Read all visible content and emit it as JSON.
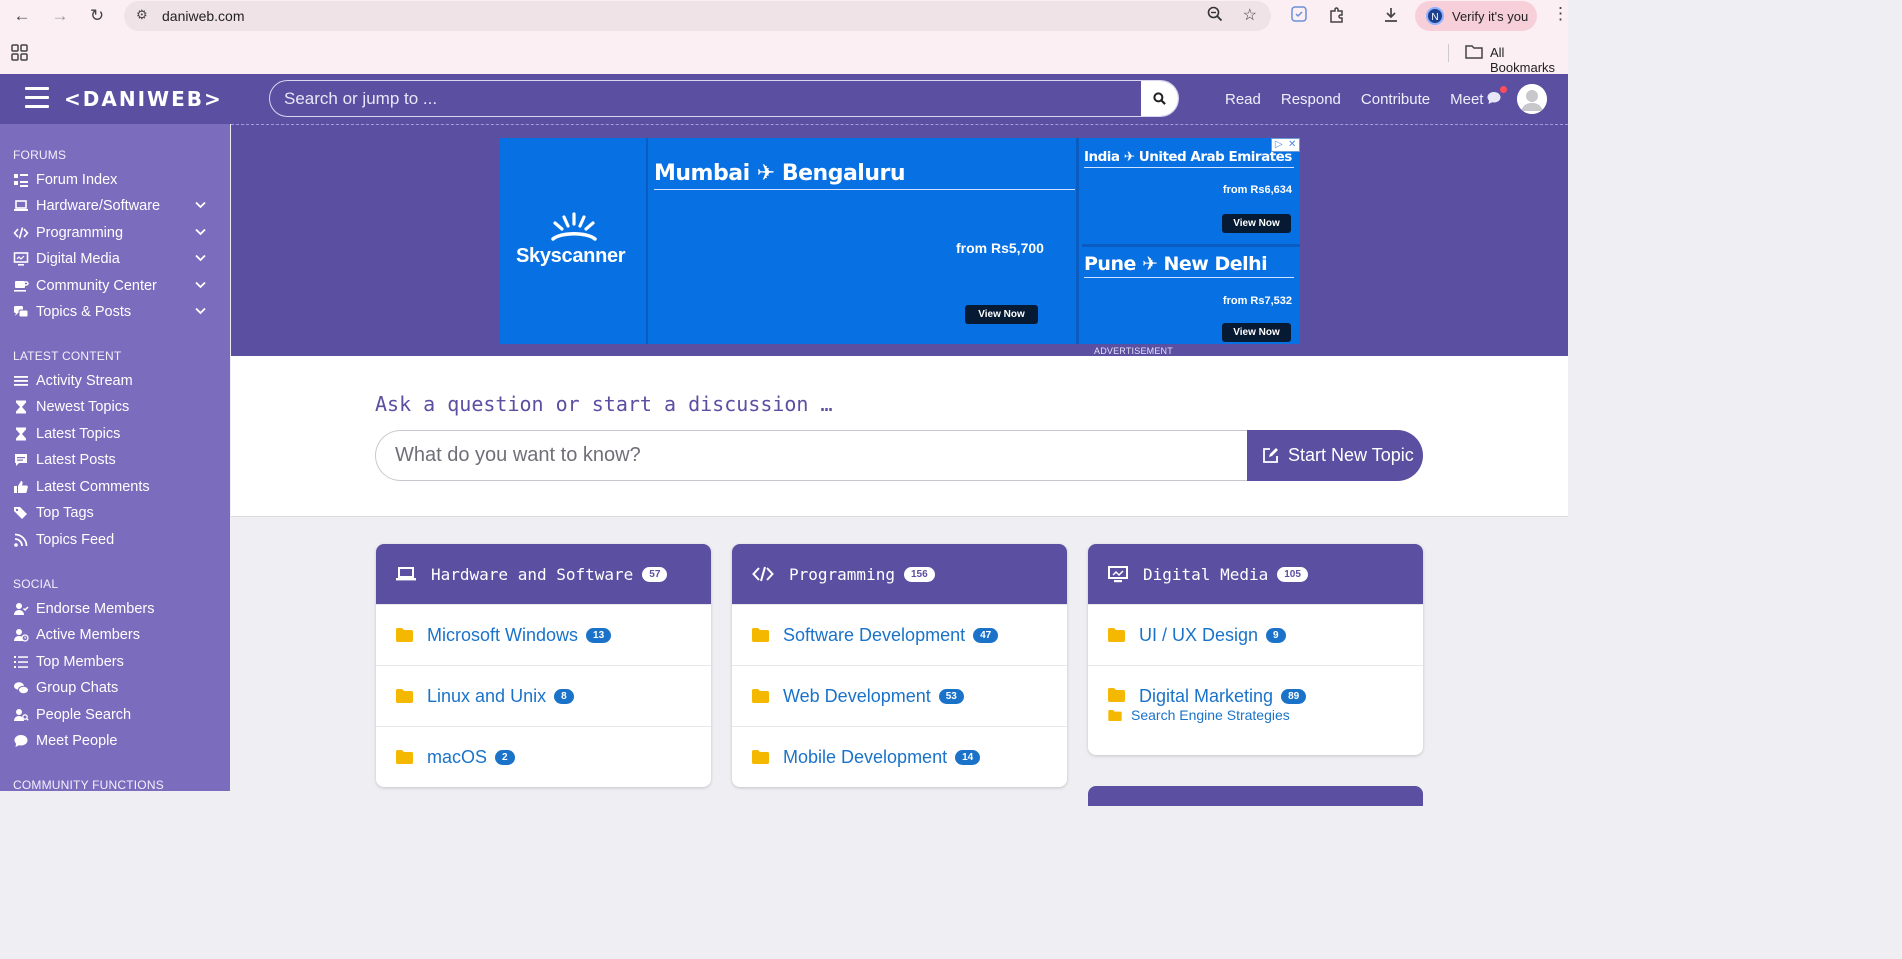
{
  "browser": {
    "url": "daniweb.com",
    "verify_label": "Verify it's you",
    "profile_initial": "N",
    "bookmarks_label": "All Bookmarks"
  },
  "header": {
    "logo": "<DANIWEB>",
    "search_placeholder": "Search or jump to ...",
    "links": [
      "Read",
      "Respond",
      "Contribute",
      "Meet"
    ]
  },
  "sidebar": {
    "forums_heading": "FORUMS",
    "forums": [
      "Forum Index",
      "Hardware/Software",
      "Programming",
      "Digital Media",
      "Community Center",
      "Topics & Posts"
    ],
    "latest_heading": "LATEST CONTENT",
    "latest": [
      "Activity Stream",
      "Newest Topics",
      "Latest Topics",
      "Latest Posts",
      "Latest Comments",
      "Top Tags",
      "Topics Feed"
    ],
    "social_heading": "SOCIAL",
    "social": [
      "Endorse Members",
      "Active Members",
      "Top Members",
      "Group Chats",
      "People Search",
      "Meet People"
    ],
    "community_heading": "COMMUNITY FUNCTIONS"
  },
  "ad": {
    "brand": "Skyscanner",
    "main_route": "Mumbai ✈ Bengaluru",
    "main_price": "from Rs5,700",
    "side1_route": "India ✈ United Arab Emirates",
    "side1_price": "from Rs6,634",
    "side2_route": "Pune ✈ New Delhi",
    "side2_price": "from Rs7,532",
    "cta": "View Now",
    "label": "ADVERTISEMENT"
  },
  "ask": {
    "title": "Ask a question or start a discussion …",
    "placeholder": "What do you want to know?",
    "button": "Start New Topic"
  },
  "cards": [
    {
      "title": "Hardware and Software",
      "count": "57",
      "rows": [
        {
          "label": "Microsoft Windows",
          "count": "13"
        },
        {
          "label": "Linux and Unix",
          "count": "8"
        },
        {
          "label": "macOS",
          "count": "2"
        }
      ]
    },
    {
      "title": "Programming",
      "count": "156",
      "rows": [
        {
          "label": "Software Development",
          "count": "47"
        },
        {
          "label": "Web Development",
          "count": "53"
        },
        {
          "label": "Mobile Development",
          "count": "14"
        }
      ]
    },
    {
      "title": "Digital Media",
      "count": "105",
      "rows": [
        {
          "label": "UI / UX Design",
          "count": "9"
        },
        {
          "label": "Digital Marketing",
          "count": "89",
          "sub": "Search Engine Strategies"
        }
      ]
    }
  ],
  "colors": {
    "brand_purple": "#5b4fa1",
    "sidebar_purple": "#7b6cbd",
    "link_blue": "#1a73c9",
    "folder_yellow": "#f5b800",
    "ad_blue": "#0770e3"
  }
}
